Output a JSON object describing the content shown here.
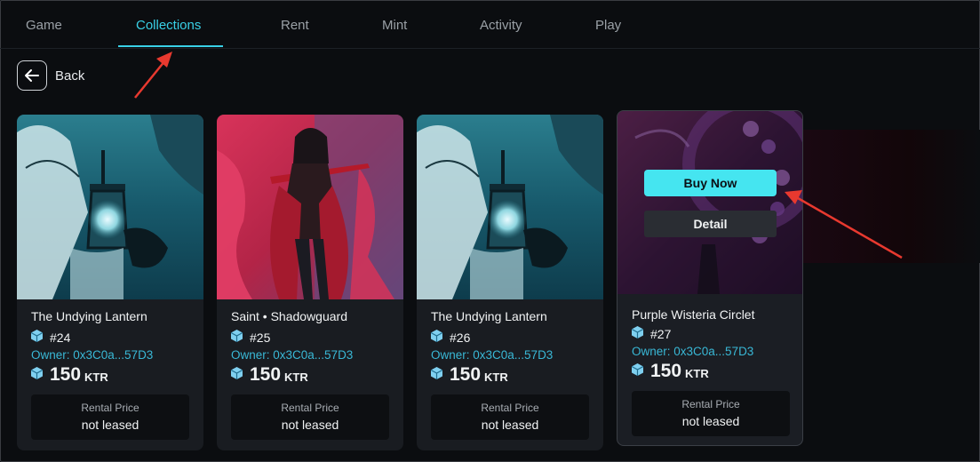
{
  "tabs": [
    {
      "label": "Game",
      "active": false
    },
    {
      "label": "Collections",
      "active": true
    },
    {
      "label": "Rent",
      "active": false
    },
    {
      "label": "Mint",
      "active": false
    },
    {
      "label": "Activity",
      "active": false
    },
    {
      "label": "Play",
      "active": false
    }
  ],
  "back": {
    "label": "Back",
    "icon": "arrow-left-icon"
  },
  "colors": {
    "accent": "#39d0e6",
    "owner": "#39b8d6",
    "buy_button": "#45e5f0",
    "annotation_arrow": "#e8392f"
  },
  "cards": [
    {
      "title": "The Undying Lantern",
      "id": "#24",
      "owner": "Owner: 0x3C0a...57D3",
      "price": "150",
      "currency": "KTR",
      "rental_label": "Rental Price",
      "rental_value": "not leased"
    },
    {
      "title": "Saint • Shadowguard",
      "id": "#25",
      "owner": "Owner: 0x3C0a...57D3",
      "price": "150",
      "currency": "KTR",
      "rental_label": "Rental Price",
      "rental_value": "not leased"
    },
    {
      "title": "The Undying Lantern",
      "id": "#26",
      "owner": "Owner: 0x3C0a...57D3",
      "price": "150",
      "currency": "KTR",
      "rental_label": "Rental Price",
      "rental_value": "not leased"
    },
    {
      "title": "Purple Wisteria Circlet",
      "id": "#27",
      "owner": "Owner: 0x3C0a...57D3",
      "price": "150",
      "currency": "KTR",
      "rental_label": "Rental Price",
      "rental_value": "not leased",
      "buy_label": "Buy Now",
      "detail_label": "Detail"
    }
  ]
}
